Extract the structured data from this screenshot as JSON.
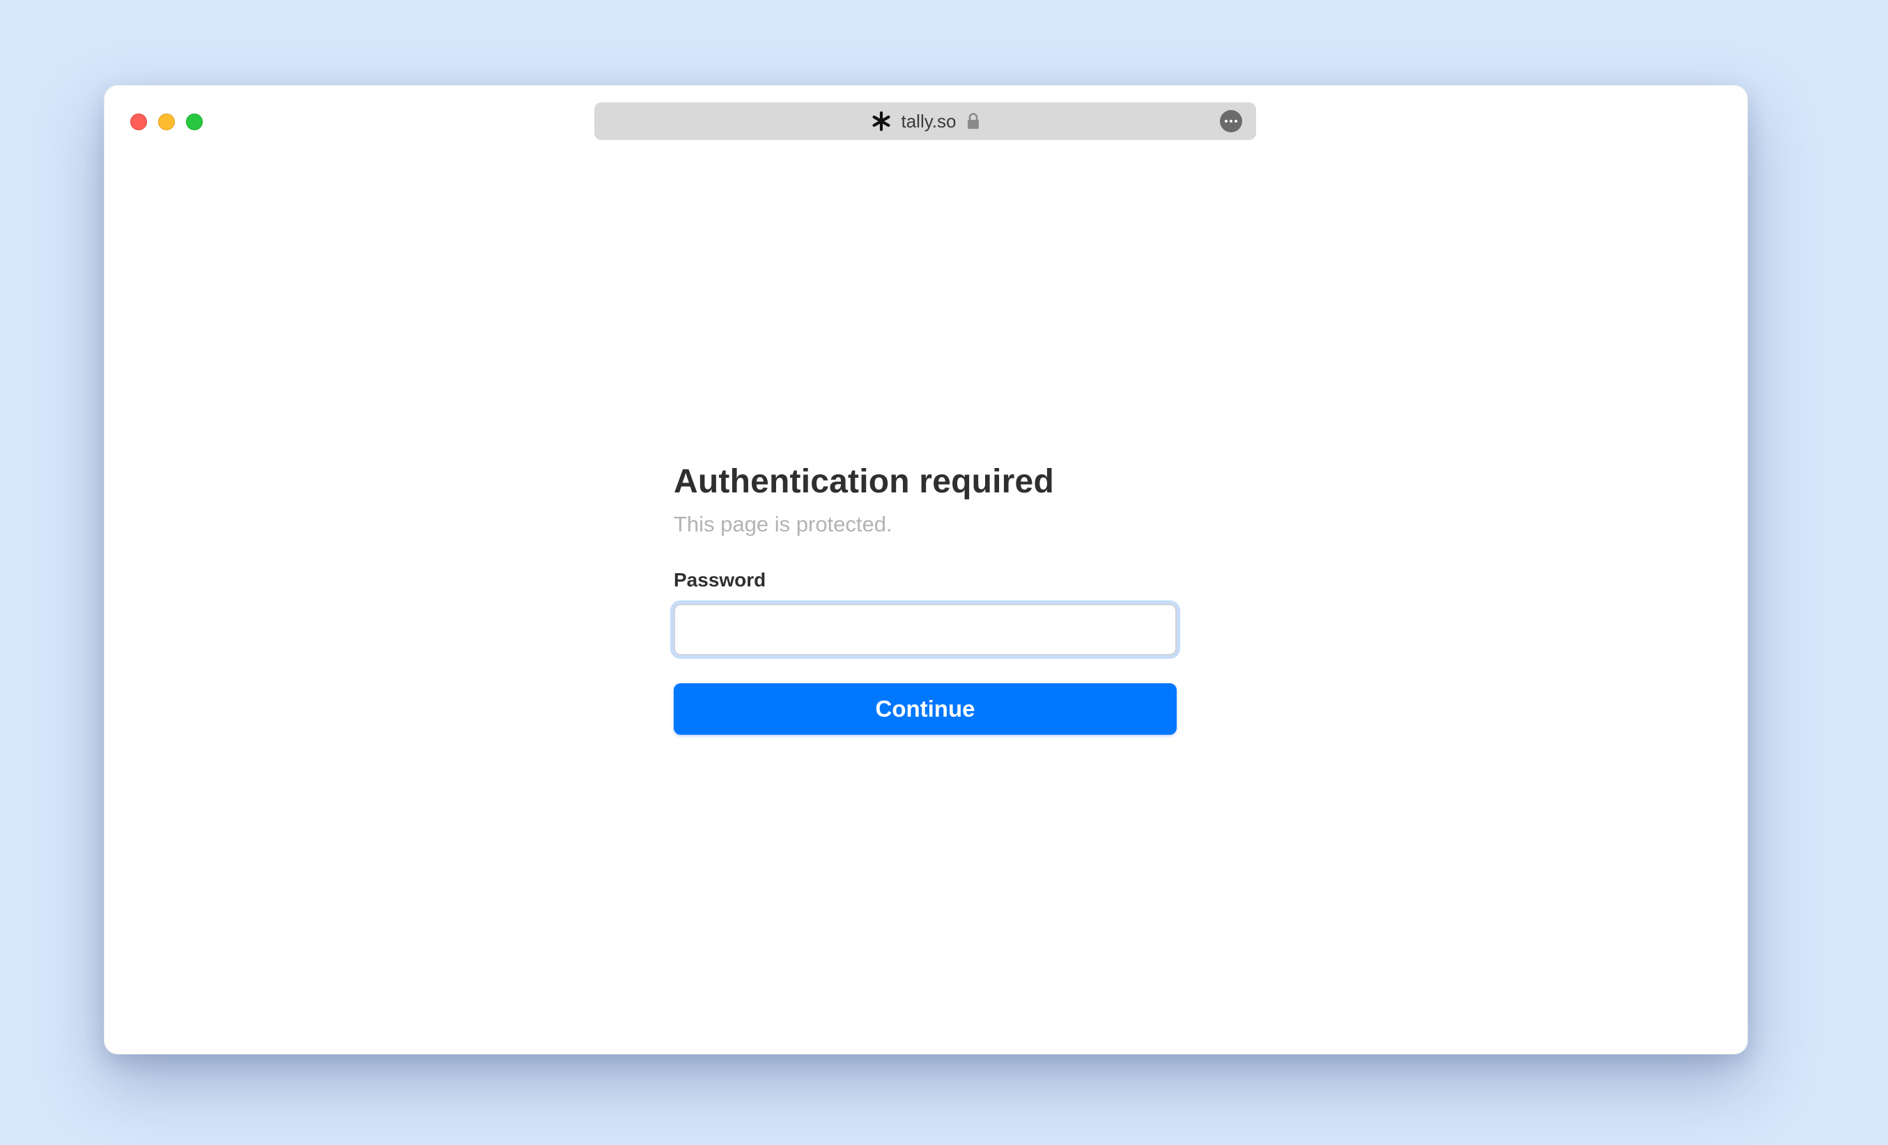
{
  "browser": {
    "url_text": "tally.so",
    "site_icon": "asterisk-icon",
    "lock_icon": "lock-icon",
    "more_icon": "ellipsis-circle-icon"
  },
  "auth": {
    "title": "Authentication required",
    "subtitle": "This page is protected.",
    "password_label": "Password",
    "password_value": "",
    "password_placeholder": "",
    "continue_label": "Continue"
  },
  "colors": {
    "accent": "#0077ff",
    "background": "#d6e6fb",
    "traffic_close": "#fe5f57",
    "traffic_minimize": "#febc2e",
    "traffic_maximize": "#28c840"
  }
}
